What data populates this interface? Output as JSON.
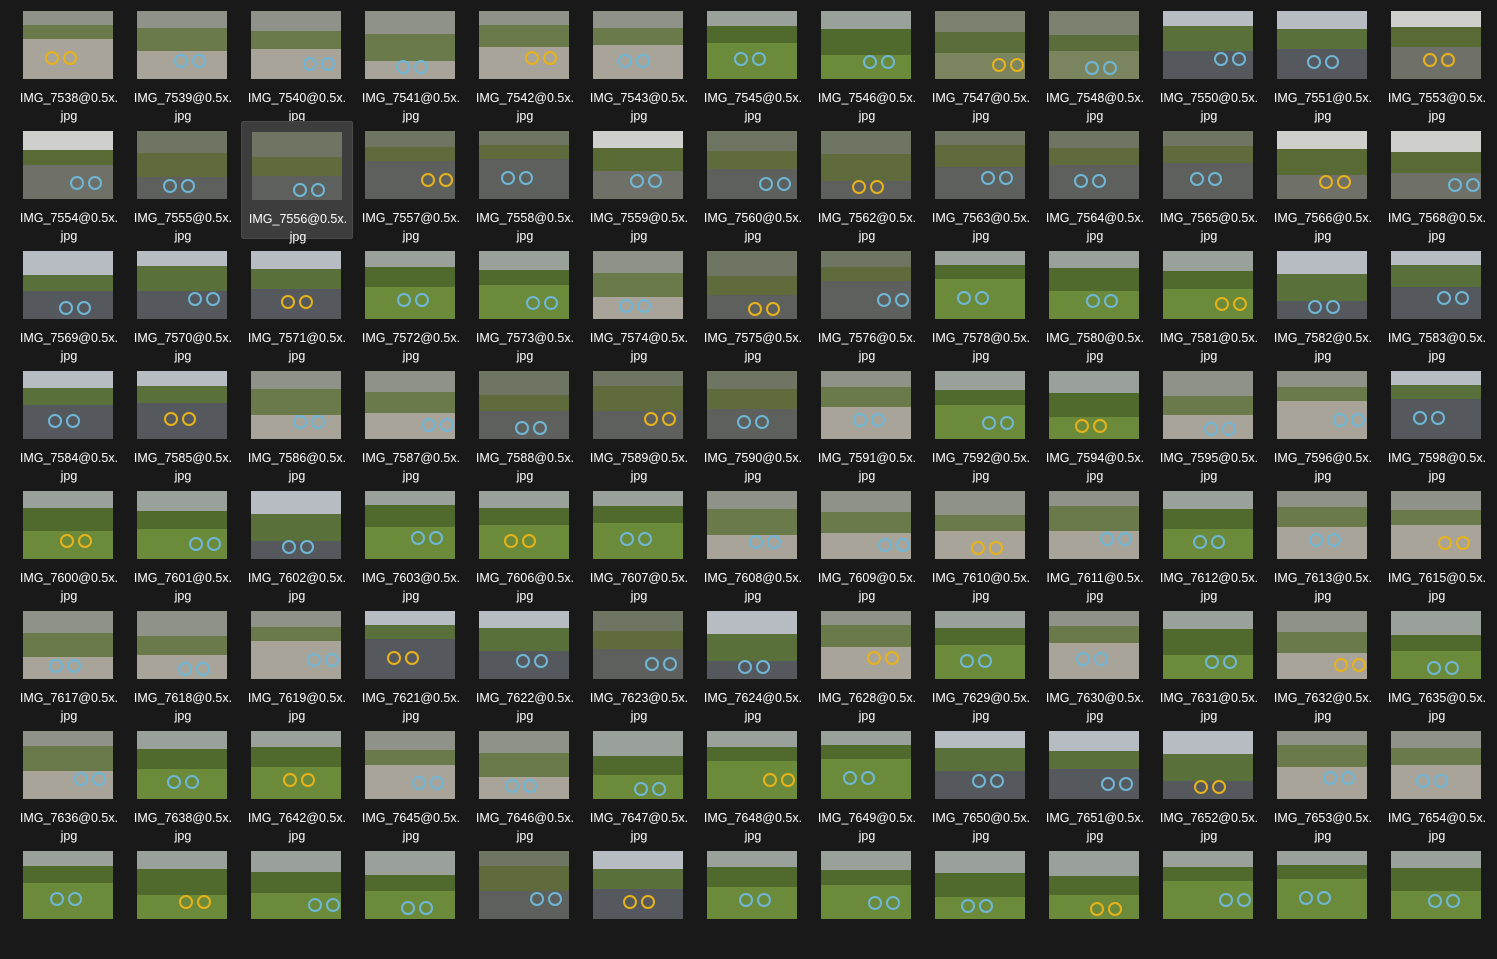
{
  "files": [
    {
      "name": "IMG_7538@0.5x.",
      "ext": "jpg",
      "scene": "path"
    },
    {
      "name": "IMG_7539@0.5x.",
      "ext": "jpg",
      "scene": "path"
    },
    {
      "name": "IMG_7540@0.5x.",
      "ext": "jpg",
      "scene": "path"
    },
    {
      "name": "IMG_7541@0.5x.",
      "ext": "jpg",
      "scene": "path"
    },
    {
      "name": "IMG_7542@0.5x.",
      "ext": "jpg",
      "scene": "path"
    },
    {
      "name": "IMG_7543@0.5x.",
      "ext": "jpg",
      "scene": "path"
    },
    {
      "name": "IMG_7545@0.5x.",
      "ext": "jpg",
      "scene": "grass"
    },
    {
      "name": "IMG_7546@0.5x.",
      "ext": "jpg",
      "scene": "grass"
    },
    {
      "name": "IMG_7547@0.5x.",
      "ext": "jpg",
      "scene": "bikes"
    },
    {
      "name": "IMG_7548@0.5x.",
      "ext": "jpg",
      "scene": "bikes"
    },
    {
      "name": "IMG_7550@0.5x.",
      "ext": "jpg",
      "scene": "road"
    },
    {
      "name": "IMG_7551@0.5x.",
      "ext": "jpg",
      "scene": "road"
    },
    {
      "name": "IMG_7553@0.5x.",
      "ext": "jpg",
      "scene": "wall"
    },
    {
      "name": "IMG_7554@0.5x.",
      "ext": "jpg",
      "scene": "wall"
    },
    {
      "name": "IMG_7555@0.5x.",
      "ext": "jpg",
      "scene": "paving"
    },
    {
      "name": "IMG_7556@0.5x.",
      "ext": "jpg",
      "scene": "paving"
    },
    {
      "name": "IMG_7557@0.5x.",
      "ext": "jpg",
      "scene": "paving"
    },
    {
      "name": "IMG_7558@0.5x.",
      "ext": "jpg",
      "scene": "paving"
    },
    {
      "name": "IMG_7559@0.5x.",
      "ext": "jpg",
      "scene": "wall"
    },
    {
      "name": "IMG_7560@0.5x.",
      "ext": "jpg",
      "scene": "paving"
    },
    {
      "name": "IMG_7562@0.5x.",
      "ext": "jpg",
      "scene": "paving"
    },
    {
      "name": "IMG_7563@0.5x.",
      "ext": "jpg",
      "scene": "paving"
    },
    {
      "name": "IMG_7564@0.5x.",
      "ext": "jpg",
      "scene": "paving"
    },
    {
      "name": "IMG_7565@0.5x.",
      "ext": "jpg",
      "scene": "paving"
    },
    {
      "name": "IMG_7566@0.5x.",
      "ext": "jpg",
      "scene": "wall"
    },
    {
      "name": "IMG_7568@0.5x.",
      "ext": "jpg",
      "scene": "wall"
    },
    {
      "name": "IMG_7569@0.5x.",
      "ext": "jpg",
      "scene": "road"
    },
    {
      "name": "IMG_7570@0.5x.",
      "ext": "jpg",
      "scene": "road"
    },
    {
      "name": "IMG_7571@0.5x.",
      "ext": "jpg",
      "scene": "road"
    },
    {
      "name": "IMG_7572@0.5x.",
      "ext": "jpg",
      "scene": "grass"
    },
    {
      "name": "IMG_7573@0.5x.",
      "ext": "jpg",
      "scene": "grass"
    },
    {
      "name": "IMG_7574@0.5x.",
      "ext": "jpg",
      "scene": "path"
    },
    {
      "name": "IMG_7575@0.5x.",
      "ext": "jpg",
      "scene": "paving"
    },
    {
      "name": "IMG_7576@0.5x.",
      "ext": "jpg",
      "scene": "paving"
    },
    {
      "name": "IMG_7578@0.5x.",
      "ext": "jpg",
      "scene": "grass"
    },
    {
      "name": "IMG_7580@0.5x.",
      "ext": "jpg",
      "scene": "grass"
    },
    {
      "name": "IMG_7581@0.5x.",
      "ext": "jpg",
      "scene": "grass"
    },
    {
      "name": "IMG_7582@0.5x.",
      "ext": "jpg",
      "scene": "road"
    },
    {
      "name": "IMG_7583@0.5x.",
      "ext": "jpg",
      "scene": "road"
    },
    {
      "name": "IMG_7584@0.5x.",
      "ext": "jpg",
      "scene": "road"
    },
    {
      "name": "IMG_7585@0.5x.",
      "ext": "jpg",
      "scene": "road"
    },
    {
      "name": "IMG_7586@0.5x.",
      "ext": "jpg",
      "scene": "path"
    },
    {
      "name": "IMG_7587@0.5x.",
      "ext": "jpg",
      "scene": "path"
    },
    {
      "name": "IMG_7588@0.5x.",
      "ext": "jpg",
      "scene": "paving"
    },
    {
      "name": "IMG_7589@0.5x.",
      "ext": "jpg",
      "scene": "paving"
    },
    {
      "name": "IMG_7590@0.5x.",
      "ext": "jpg",
      "scene": "paving"
    },
    {
      "name": "IMG_7591@0.5x.",
      "ext": "jpg",
      "scene": "path"
    },
    {
      "name": "IMG_7592@0.5x.",
      "ext": "jpg",
      "scene": "grass"
    },
    {
      "name": "IMG_7594@0.5x.",
      "ext": "jpg",
      "scene": "grass"
    },
    {
      "name": "IMG_7595@0.5x.",
      "ext": "jpg",
      "scene": "path"
    },
    {
      "name": "IMG_7596@0.5x.",
      "ext": "jpg",
      "scene": "path"
    },
    {
      "name": "IMG_7598@0.5x.",
      "ext": "jpg",
      "scene": "road"
    },
    {
      "name": "IMG_7600@0.5x.",
      "ext": "jpg",
      "scene": "grass"
    },
    {
      "name": "IMG_7601@0.5x.",
      "ext": "jpg",
      "scene": "grass"
    },
    {
      "name": "IMG_7602@0.5x.",
      "ext": "jpg",
      "scene": "road"
    },
    {
      "name": "IMG_7603@0.5x.",
      "ext": "jpg",
      "scene": "grass"
    },
    {
      "name": "IMG_7606@0.5x.",
      "ext": "jpg",
      "scene": "grass"
    },
    {
      "name": "IMG_7607@0.5x.",
      "ext": "jpg",
      "scene": "grass"
    },
    {
      "name": "IMG_7608@0.5x.",
      "ext": "jpg",
      "scene": "path"
    },
    {
      "name": "IMG_7609@0.5x.",
      "ext": "jpg",
      "scene": "path"
    },
    {
      "name": "IMG_7610@0.5x.",
      "ext": "jpg",
      "scene": "path"
    },
    {
      "name": "IMG_7611@0.5x.",
      "ext": "jpg",
      "scene": "path"
    },
    {
      "name": "IMG_7612@0.5x.",
      "ext": "jpg",
      "scene": "grass"
    },
    {
      "name": "IMG_7613@0.5x.",
      "ext": "jpg",
      "scene": "path"
    },
    {
      "name": "IMG_7615@0.5x.",
      "ext": "jpg",
      "scene": "path"
    },
    {
      "name": "IMG_7617@0.5x.",
      "ext": "jpg",
      "scene": "path"
    },
    {
      "name": "IMG_7618@0.5x.",
      "ext": "jpg",
      "scene": "path"
    },
    {
      "name": "IMG_7619@0.5x.",
      "ext": "jpg",
      "scene": "path"
    },
    {
      "name": "IMG_7621@0.5x.",
      "ext": "jpg",
      "scene": "road"
    },
    {
      "name": "IMG_7622@0.5x.",
      "ext": "jpg",
      "scene": "road"
    },
    {
      "name": "IMG_7623@0.5x.",
      "ext": "jpg",
      "scene": "paving"
    },
    {
      "name": "IMG_7624@0.5x.",
      "ext": "jpg",
      "scene": "road"
    },
    {
      "name": "IMG_7628@0.5x.",
      "ext": "jpg",
      "scene": "path"
    },
    {
      "name": "IMG_7629@0.5x.",
      "ext": "jpg",
      "scene": "grass"
    },
    {
      "name": "IMG_7630@0.5x.",
      "ext": "jpg",
      "scene": "path"
    },
    {
      "name": "IMG_7631@0.5x.",
      "ext": "jpg",
      "scene": "grass"
    },
    {
      "name": "IMG_7632@0.5x.",
      "ext": "jpg",
      "scene": "path"
    },
    {
      "name": "IMG_7635@0.5x.",
      "ext": "jpg",
      "scene": "grass"
    },
    {
      "name": "IMG_7636@0.5x.",
      "ext": "jpg",
      "scene": "path"
    },
    {
      "name": "IMG_7638@0.5x.",
      "ext": "jpg",
      "scene": "grass"
    },
    {
      "name": "IMG_7642@0.5x.",
      "ext": "jpg",
      "scene": "grass"
    },
    {
      "name": "IMG_7645@0.5x.",
      "ext": "jpg",
      "scene": "path"
    },
    {
      "name": "IMG_7646@0.5x.",
      "ext": "jpg",
      "scene": "path"
    },
    {
      "name": "IMG_7647@0.5x.",
      "ext": "jpg",
      "scene": "grass"
    },
    {
      "name": "IMG_7648@0.5x.",
      "ext": "jpg",
      "scene": "grass"
    },
    {
      "name": "IMG_7649@0.5x.",
      "ext": "jpg",
      "scene": "grass"
    },
    {
      "name": "IMG_7650@0.5x.",
      "ext": "jpg",
      "scene": "road"
    },
    {
      "name": "IMG_7651@0.5x.",
      "ext": "jpg",
      "scene": "road"
    },
    {
      "name": "IMG_7652@0.5x.",
      "ext": "jpg",
      "scene": "road"
    },
    {
      "name": "IMG_7653@0.5x.",
      "ext": "jpg",
      "scene": "path"
    },
    {
      "name": "IMG_7654@0.5x.",
      "ext": "jpg",
      "scene": "path"
    },
    {
      "name": "",
      "ext": "",
      "scene": "grass"
    },
    {
      "name": "",
      "ext": "",
      "scene": "grass"
    },
    {
      "name": "",
      "ext": "",
      "scene": "grass"
    },
    {
      "name": "",
      "ext": "",
      "scene": "grass"
    },
    {
      "name": "",
      "ext": "",
      "scene": "paving"
    },
    {
      "name": "",
      "ext": "",
      "scene": "road"
    },
    {
      "name": "",
      "ext": "",
      "scene": "grass"
    },
    {
      "name": "",
      "ext": "",
      "scene": "grass"
    },
    {
      "name": "",
      "ext": "",
      "scene": "grass"
    },
    {
      "name": "",
      "ext": "",
      "scene": "grass"
    },
    {
      "name": "",
      "ext": "",
      "scene": "grass"
    },
    {
      "name": "",
      "ext": "",
      "scene": "grass"
    },
    {
      "name": "",
      "ext": "",
      "scene": "grass"
    }
  ],
  "selected_file": "IMG_7556@0.5x.",
  "colors": {
    "background": "#191919",
    "selected_tile": "#3d3d3d",
    "label_text": "#ffffff",
    "bike_blue": "#6fb7d6",
    "bike_yellow": "#e7b21a"
  }
}
